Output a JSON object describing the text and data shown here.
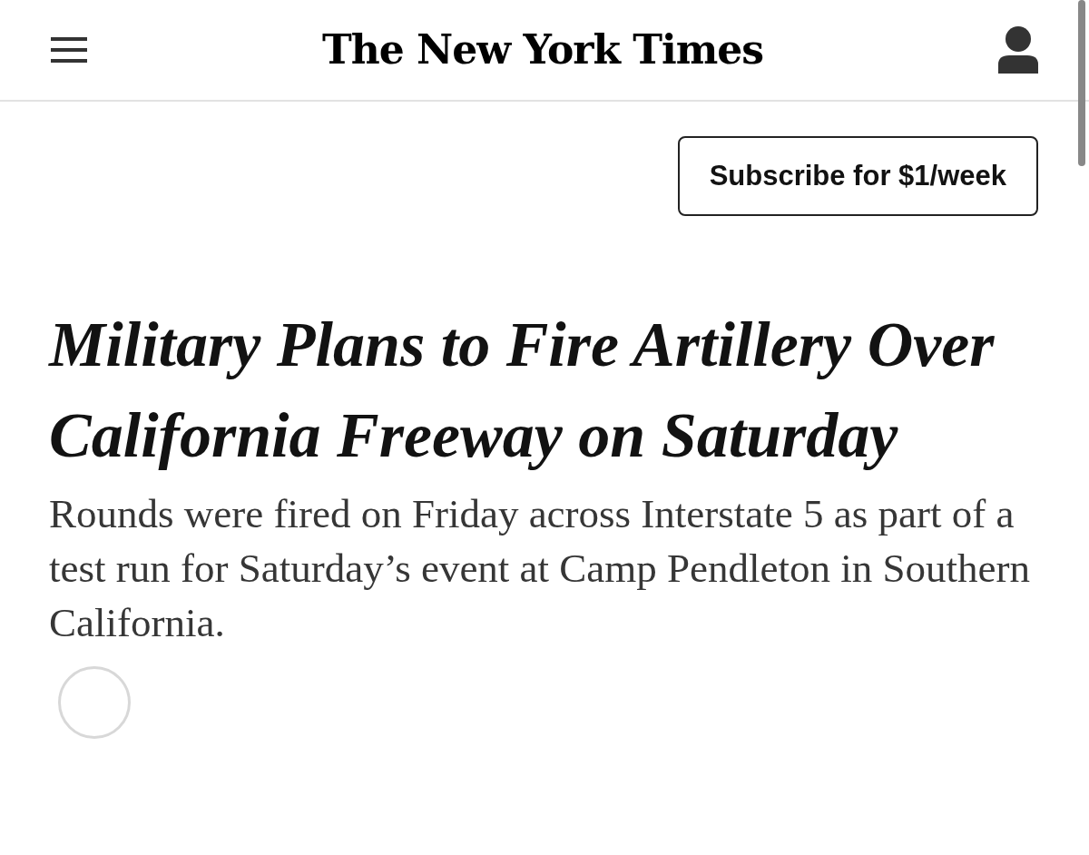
{
  "header": {
    "logo": "The New York Times"
  },
  "subscribe_button": {
    "label": "Subscribe for $1/week"
  },
  "article": {
    "headline": "Military Plans to Fire Artillery Over California Freeway on Saturday",
    "summary": "Rounds were fired on Friday across Interstate 5 as part of a test run for Saturday’s event at Camp Pendleton in Southern California."
  }
}
